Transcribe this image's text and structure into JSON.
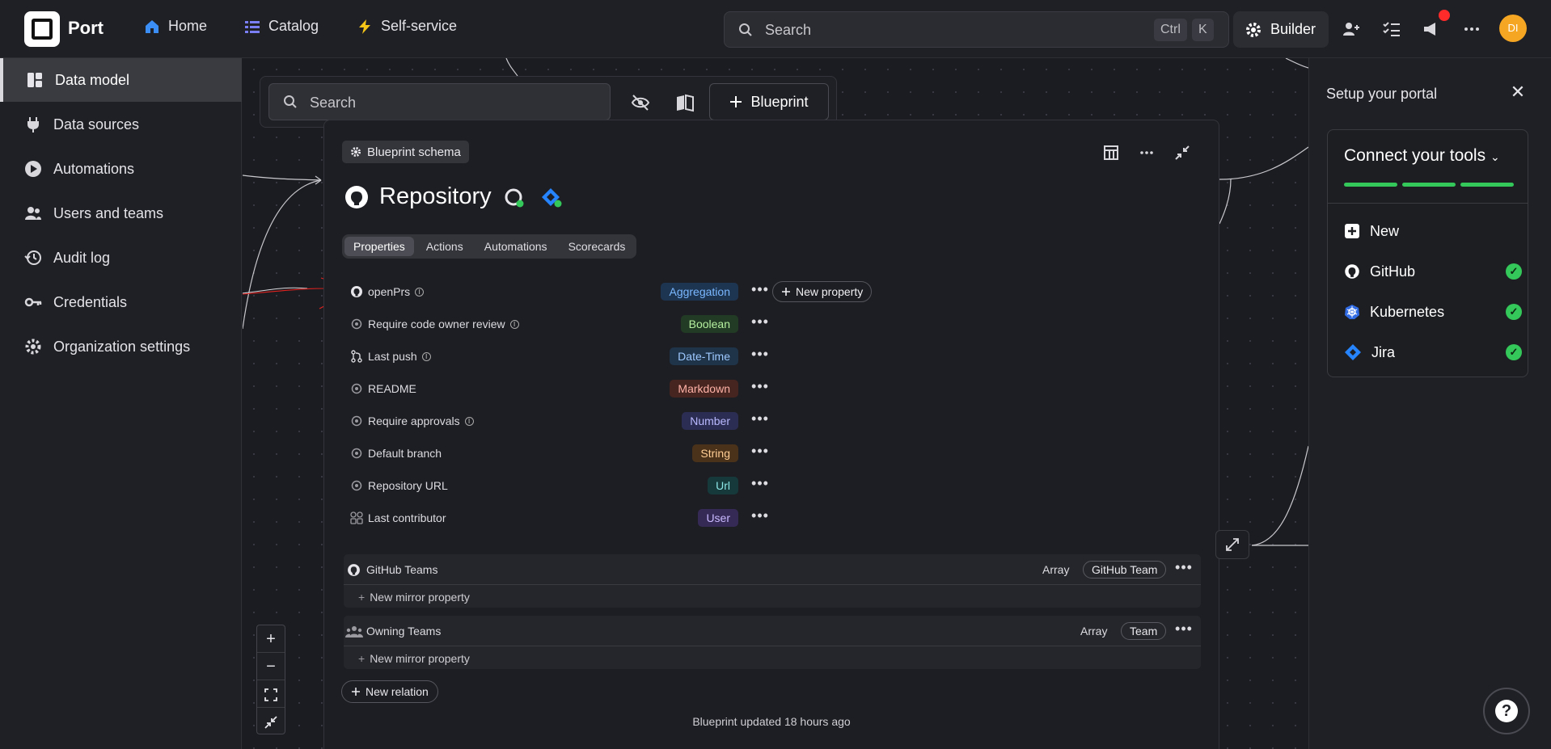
{
  "app": {
    "name": "Port"
  },
  "nav": [
    {
      "label": "Home",
      "icon": "home-icon"
    },
    {
      "label": "Catalog",
      "icon": "catalog-icon"
    },
    {
      "label": "Self-service",
      "icon": "lightning-icon"
    }
  ],
  "search": {
    "placeholder": "Search",
    "kbd1": "Ctrl",
    "kbd2": "K"
  },
  "builder": {
    "label": "Builder"
  },
  "user": {
    "initials": "DI"
  },
  "sidebar": [
    {
      "label": "Data model",
      "icon": "data-model-icon",
      "active": true
    },
    {
      "label": "Data sources",
      "icon": "plug-icon"
    },
    {
      "label": "Automations",
      "icon": "play-icon"
    },
    {
      "label": "Users and teams",
      "icon": "users-icon"
    },
    {
      "label": "Audit log",
      "icon": "history-icon"
    },
    {
      "label": "Credentials",
      "icon": "key-icon"
    },
    {
      "label": "Organization settings",
      "icon": "gear-icon"
    }
  ],
  "toolbar": {
    "search_placeholder": "Search",
    "blueprint_label": "Blueprint"
  },
  "blueprint": {
    "chip": "Blueprint schema",
    "title": "Repository",
    "tabs": [
      "Properties",
      "Actions",
      "Automations",
      "Scorecards"
    ],
    "properties": [
      {
        "name": "openPrs",
        "type": "Aggregation",
        "info": true,
        "color": "#7ab8ff",
        "bg": "#1e3552"
      },
      {
        "name": "Require code owner review",
        "type": "Boolean",
        "info": true,
        "color": "#b5f0a0",
        "bg": "#223b24"
      },
      {
        "name": "Last push",
        "type": "Date-Time",
        "info": true,
        "color": "#9ec9ff",
        "bg": "#1f3349"
      },
      {
        "name": "README",
        "type": "Markdown",
        "info": false,
        "color": "#ffb3a8",
        "bg": "#46241f"
      },
      {
        "name": "Require approvals",
        "type": "Number",
        "info": true,
        "color": "#b9b9ff",
        "bg": "#2c2d52"
      },
      {
        "name": "Default branch",
        "type": "String",
        "info": false,
        "color": "#ffcd94",
        "bg": "#4a321a"
      },
      {
        "name": "Repository URL",
        "type": "Url",
        "info": false,
        "color": "#8ce6e6",
        "bg": "#16393b"
      },
      {
        "name": "Last contributor",
        "type": "User",
        "info": false,
        "color": "#c9b8ff",
        "bg": "#352a55"
      }
    ],
    "new_property": "New property",
    "relations": [
      {
        "name": "GitHub Teams",
        "array": "Array",
        "target": "GitHub Team",
        "mirror": "New mirror property"
      },
      {
        "name": "Owning Teams",
        "array": "Array",
        "target": "Team",
        "mirror": "New mirror property"
      }
    ],
    "new_relation": "New relation",
    "updated": "Blueprint updated 18 hours ago"
  },
  "right_panel": {
    "title": "Setup your portal",
    "card_title": "Connect your tools",
    "tools": [
      {
        "label": "New",
        "icon": "plus-square-icon"
      },
      {
        "label": "GitHub",
        "icon": "github-icon",
        "done": true
      },
      {
        "label": "Kubernetes",
        "icon": "kubernetes-icon",
        "done": true
      },
      {
        "label": "Jira",
        "icon": "jira-icon",
        "done": true
      }
    ]
  },
  "colors": {
    "accent_green": "#34c759",
    "avatar": "#f5a623",
    "notification": "#ff2a2a"
  }
}
